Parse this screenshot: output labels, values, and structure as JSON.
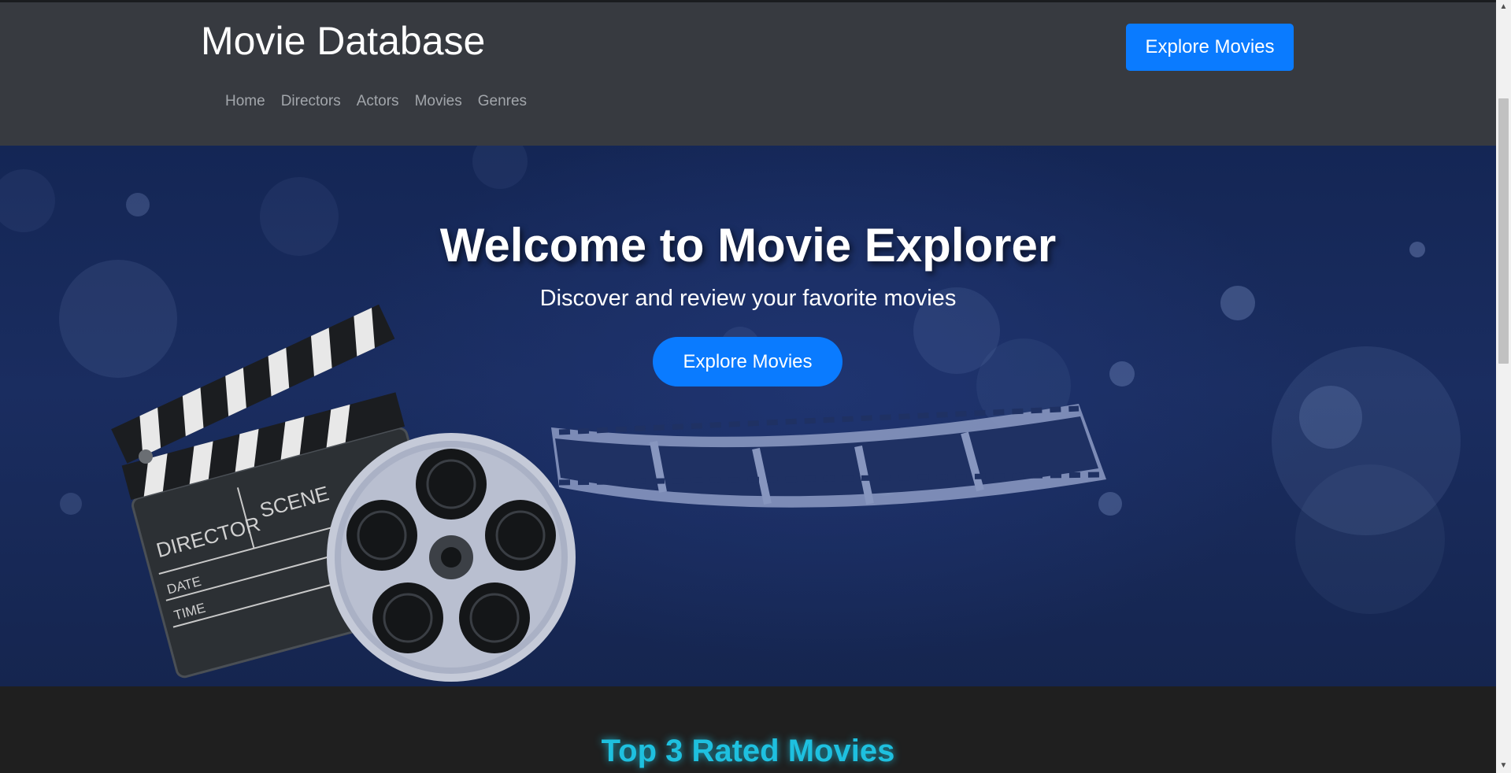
{
  "header": {
    "brand": "Movie Database",
    "explore_button": "Explore Movies",
    "nav": [
      "Home",
      "Directors",
      "Actors",
      "Movies",
      "Genres"
    ]
  },
  "hero": {
    "title": "Welcome to Movie Explorer",
    "subtitle": "Discover and review your favorite movies",
    "button": "Explore Movies",
    "clapboard": {
      "director": "DIRECTOR",
      "scene": "SCENE",
      "date": "DATE",
      "time": "TIME"
    }
  },
  "section": {
    "title": "Top 3 Rated Movies"
  },
  "colors": {
    "header_bg": "#373a40",
    "accent_blue": "#0a7bff",
    "hero_bg": "#1a2d60",
    "section_title": "#1ec0df",
    "page_bg": "#1f1f1f"
  },
  "icons": {
    "scroll_up": "▲",
    "scroll_down": "▼"
  }
}
